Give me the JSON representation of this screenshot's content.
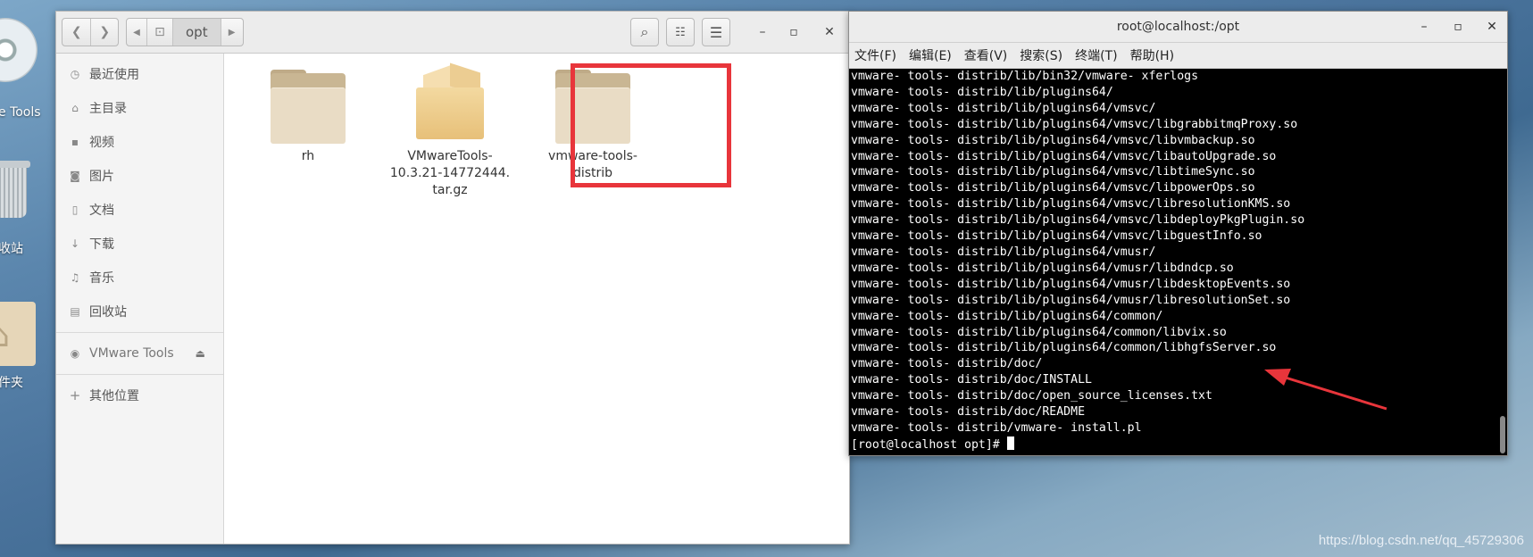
{
  "desktop": {
    "tools_label": "e Tools",
    "trash_label": "收站",
    "home_label": "件夹",
    "watermark": "https://blog.csdn.net/qq_45729306"
  },
  "file_manager": {
    "path_current": "opt",
    "sidebar": [
      {
        "icon": "clock-icon",
        "label": "最近使用"
      },
      {
        "icon": "home-icon",
        "label": "主目录"
      },
      {
        "icon": "video-icon",
        "label": "视频"
      },
      {
        "icon": "camera-icon",
        "label": "图片"
      },
      {
        "icon": "document-icon",
        "label": "文档"
      },
      {
        "icon": "download-icon",
        "label": "下载"
      },
      {
        "icon": "music-icon",
        "label": "音乐"
      },
      {
        "icon": "trash-icon",
        "label": "回收站"
      },
      {
        "icon": "disc-icon",
        "label": "VMware Tools"
      },
      {
        "icon": "plus-icon",
        "label": "其他位置"
      }
    ],
    "files": [
      {
        "type": "folder",
        "name": "rh"
      },
      {
        "type": "archive",
        "name": "VMwareTools-10.3.21-14772444.tar.gz",
        "name_lines": [
          "VMwareTools-",
          "10.3.21-14772444.",
          "tar.gz"
        ]
      },
      {
        "type": "folder",
        "name": "vmware-tools-distrib"
      }
    ]
  },
  "terminal": {
    "title": "root@localhost:/opt",
    "menu": [
      "文件(F)",
      "编辑(E)",
      "查看(V)",
      "搜索(S)",
      "终端(T)",
      "帮助(H)"
    ],
    "lines": [
      "vmware- tools- distrib/lib/bin32/vmware- xferlogs",
      "vmware- tools- distrib/lib/plugins64/",
      "vmware- tools- distrib/lib/plugins64/vmsvc/",
      "vmware- tools- distrib/lib/plugins64/vmsvc/libgrabbitmqProxy.so",
      "vmware- tools- distrib/lib/plugins64/vmsvc/libvmbackup.so",
      "vmware- tools- distrib/lib/plugins64/vmsvc/libautoUpgrade.so",
      "vmware- tools- distrib/lib/plugins64/vmsvc/libtimeSync.so",
      "vmware- tools- distrib/lib/plugins64/vmsvc/libpowerOps.so",
      "vmware- tools- distrib/lib/plugins64/vmsvc/libresolutionKMS.so",
      "vmware- tools- distrib/lib/plugins64/vmsvc/libdeployPkgPlugin.so",
      "vmware- tools- distrib/lib/plugins64/vmsvc/libguestInfo.so",
      "vmware- tools- distrib/lib/plugins64/vmusr/",
      "vmware- tools- distrib/lib/plugins64/vmusr/libdndcp.so",
      "vmware- tools- distrib/lib/plugins64/vmusr/libdesktopEvents.so",
      "vmware- tools- distrib/lib/plugins64/vmusr/libresolutionSet.so",
      "vmware- tools- distrib/lib/plugins64/common/",
      "vmware- tools- distrib/lib/plugins64/common/libvix.so",
      "vmware- tools- distrib/lib/plugins64/common/libhgfsServer.so",
      "vmware- tools- distrib/doc/",
      "vmware- tools- distrib/doc/INSTALL",
      "vmware- tools- distrib/doc/open_source_licenses.txt",
      "vmware- tools- distrib/doc/README",
      "vmware- tools- distrib/vmware- install.pl"
    ],
    "prompt": "[root@localhost opt]# "
  },
  "colors": {
    "highlight": "#e8353b",
    "arrow": "#e8353b",
    "terminal_bg": "#000000"
  }
}
